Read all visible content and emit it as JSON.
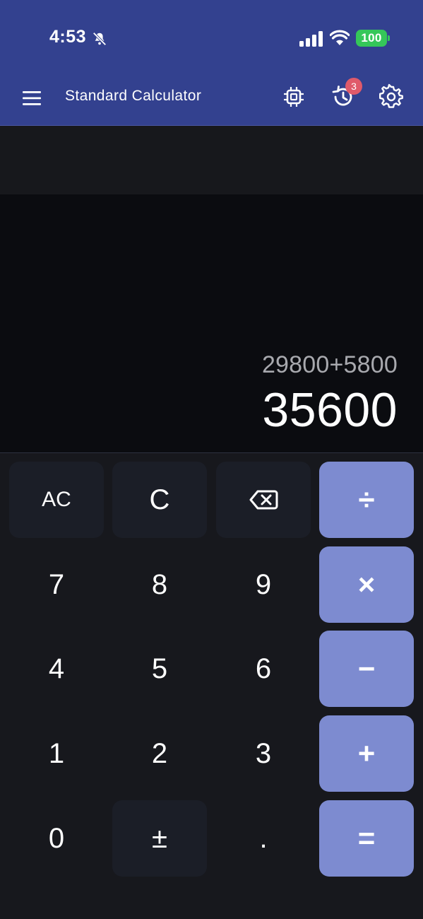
{
  "status_bar": {
    "time": "4:53",
    "battery": "100",
    "battery_color": "#35c759"
  },
  "app_bar": {
    "title": "Standard Calculator",
    "history_badge_count": "3",
    "background_color": "#33418f"
  },
  "display": {
    "expression": "29800+5800",
    "result": "35600"
  },
  "keypad": {
    "row1": {
      "ac": "AC",
      "c": "C",
      "backspace": "backspace-icon",
      "divide": "÷"
    },
    "row2": {
      "seven": "7",
      "eight": "8",
      "nine": "9",
      "multiply": "×"
    },
    "row3": {
      "four": "4",
      "five": "5",
      "six": "6",
      "minus": "−"
    },
    "row4": {
      "one": "1",
      "two": "2",
      "three": "3",
      "plus": "+"
    },
    "row5": {
      "zero": "0",
      "plus_minus": "±",
      "decimal": ".",
      "equals": "="
    },
    "operator_color": "#7d8bd0"
  }
}
